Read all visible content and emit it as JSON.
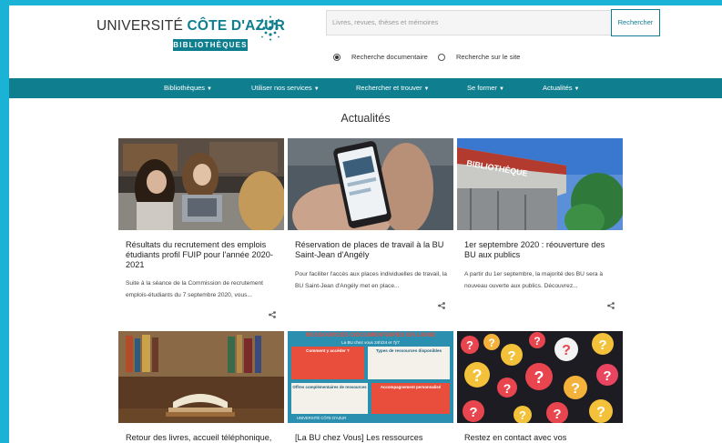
{
  "header": {
    "logo_main": "UNIVERSITÉ",
    "logo_accent": "CÔTE D'AZUR",
    "logo_sub": "BIBLIOTHÈQUES",
    "search_placeholder": "Livres, revues, thèses et mémoires",
    "search_button": "Rechercher",
    "radio_documentary": "Recherche documentaire",
    "radio_site": "Recherche sur le site"
  },
  "nav": {
    "items": [
      "Bibliothèques",
      "Utiliser nos services",
      "Rechercher et trouver",
      "Se former",
      "Actualités"
    ]
  },
  "main": {
    "title": "Actualités",
    "cards": [
      {
        "title": "Résultats du recrutement des emplois étudiants profil FUIP pour l'année 2020-2021",
        "excerpt": "Suite à la séance de la Commission de recrutement emplois-étudiants du 7 septembre 2020, vous..."
      },
      {
        "title": "Réservation de places de travail à la BU Saint-Jean d'Angély",
        "excerpt": "Pour faciliter l'accès aux places individuelles de travail, la BU Saint-Jean d'Angély met en place..."
      },
      {
        "title": "1er septembre 2020 : réouverture des BU aux publics",
        "excerpt": "A partir du 1er septembre, la majorité des BU sera à nouveau ouverte aux publics. Découvrez..."
      },
      {
        "title": "Retour des livres, accueil téléphonique,",
        "excerpt": ""
      },
      {
        "title": "[La BU chez Vous] Les ressources",
        "excerpt": ""
      },
      {
        "title": "Restez en contact avec vos",
        "excerpt": ""
      }
    ],
    "poster": {
      "heading": "RESSOURCES DOCUMENTAIRES EN LIGNE",
      "subheading": "La BU chez vous 24h/24 et 7j/7",
      "box1": "Comment y accéder ?",
      "box2": "Types de ressources disponibles",
      "box3": "Offres complémentaires de ressources",
      "box4": "Accompagnement personnalisé",
      "footer": "UNIVERSITÉ CÔTE D'AZUR"
    }
  },
  "colors": {
    "teal": "#0f7f8f",
    "frame": "#1ab3d6"
  }
}
